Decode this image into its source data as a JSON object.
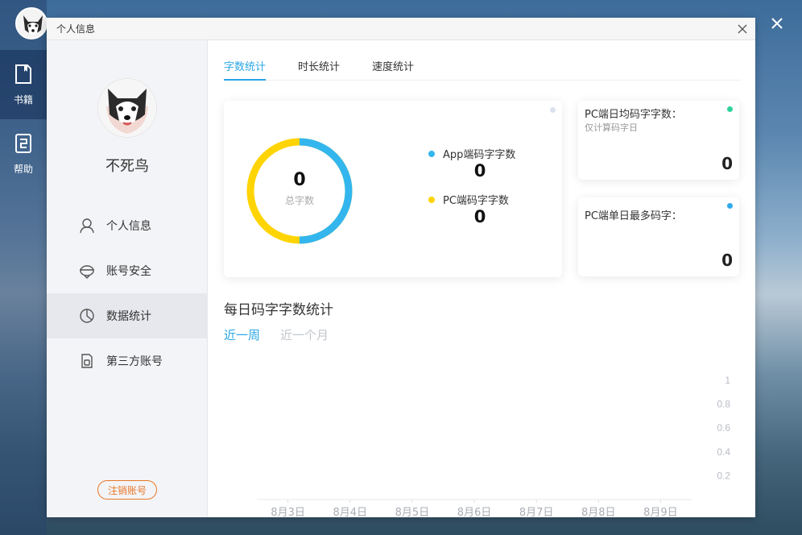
{
  "rail": {
    "items": [
      {
        "label": "书籍",
        "icon": "book-icon"
      },
      {
        "label": "帮助",
        "icon": "help-icon"
      }
    ]
  },
  "dialog": {
    "title": "个人信息"
  },
  "profile": {
    "name": "不死鸟"
  },
  "menu": [
    {
      "label": "个人信息",
      "icon": "user-icon"
    },
    {
      "label": "账号安全",
      "icon": "shield-icon"
    },
    {
      "label": "数据统计",
      "icon": "pie-chart-icon"
    },
    {
      "label": "第三方账号",
      "icon": "third-party-icon"
    }
  ],
  "logout_label": "注销账号",
  "tabs": [
    "字数统计",
    "时长统计",
    "速度统计"
  ],
  "donut": {
    "total": "0",
    "total_label": "总字数",
    "colors": {
      "app": "#33b6ee",
      "pc": "#ffd404"
    }
  },
  "legend": [
    {
      "label": "App端码字字数",
      "value": "0",
      "color": "#33b6ee"
    },
    {
      "label": "PC端码字字数",
      "value": "0",
      "color": "#ffd404"
    }
  ],
  "stats": [
    {
      "title": "PC端日均码字字数：",
      "subtitle": "仅计算码字日",
      "value": "0",
      "dot_color": "#2fd39a"
    },
    {
      "title": "PC端单日最多码字：",
      "subtitle": "",
      "value": "0",
      "dot_color": "#33a9ee"
    }
  ],
  "main_card_dot_color": "#dce3ef",
  "daily": {
    "title": "每日码字字数统计",
    "ranges": [
      "近一周",
      "近一个月"
    ]
  },
  "chart_data": {
    "type": "bar",
    "categories": [
      "8月3日",
      "8月4日",
      "8月5日",
      "8月6日",
      "8月7日",
      "8月8日",
      "8月9日"
    ],
    "values": [
      0,
      0,
      0,
      0,
      0,
      0,
      0
    ],
    "yticks": [
      "1",
      "0.8",
      "0.6",
      "0.4",
      "0.2"
    ],
    "ylim": [
      0,
      1
    ],
    "grid": false
  },
  "accent_color": "#2aa7e4",
  "danger_color": "#e8782b"
}
